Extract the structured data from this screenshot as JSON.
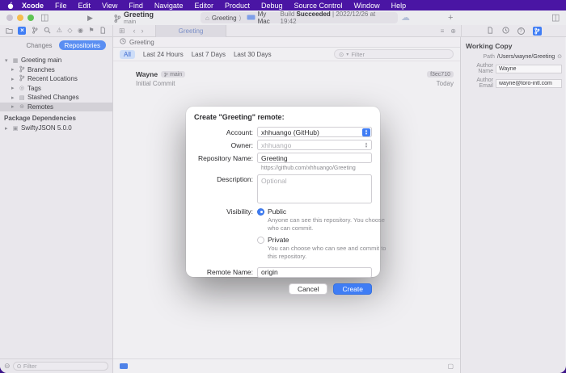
{
  "colors": {
    "accent": "#3F7DF5",
    "menubar_bg": "#4A15A4",
    "segment_selected": "#5A8EF2"
  },
  "menubar": {
    "items": [
      "Xcode",
      "File",
      "Edit",
      "View",
      "Find",
      "Navigate",
      "Editor",
      "Product",
      "Debug",
      "Source Control",
      "Window",
      "Help"
    ]
  },
  "icons": {
    "sidebar_left": "◫",
    "play": "▶",
    "cloud": "☁",
    "plus": "+",
    "sidebar_right": "◫",
    "grid": "⊞",
    "back": "‹",
    "forward": "›",
    "list": "≡",
    "split": "⊕",
    "warning": "⚠",
    "diamond": "◇",
    "gauge": "◉",
    "flag": "⚑",
    "scm_x": "×",
    "chevron_down": "▾",
    "chevron_right": "▸",
    "repo": "▦",
    "tags": "◎",
    "stash": "▤",
    "remotes": "⊛",
    "package": "▣",
    "minus_circle": "⊖",
    "filter_circle": "⊙",
    "reveal": "⊙",
    "house": "⌂",
    "help": "?",
    "small_square": "▢"
  },
  "toolbar": {
    "project": "Greeting",
    "branch": "main",
    "scheme": "Greeting",
    "scheme_sep": "⟩",
    "destination": "My Mac",
    "build_prefix": "Build",
    "build_status": "Succeeded",
    "build_time": "| 2022/12/26 at 19:42"
  },
  "tabbar": {
    "active_tab": "Greeting"
  },
  "sidebar": {
    "segments": {
      "changes": "Changes",
      "repositories": "Repositories"
    },
    "tree": [
      {
        "label": "Greeting main"
      },
      {
        "label": "Branches"
      },
      {
        "label": "Recent Locations"
      },
      {
        "label": "Tags"
      },
      {
        "label": "Stashed Changes"
      },
      {
        "label": "Remotes"
      }
    ],
    "section_title": "Package Dependencies",
    "package": "SwiftyJSON 5.0.0",
    "filter_placeholder": "Filter"
  },
  "editor": {
    "jumpbar": "Greeting",
    "filters": [
      "All",
      "Last 24 Hours",
      "Last 7 Days",
      "Last 30 Days"
    ],
    "filter_placeholder": "Filter",
    "commit": {
      "author": "Wayne",
      "branch_badge": "main",
      "message": "Initial Commit",
      "hash": "f3ec710",
      "date": "Today"
    }
  },
  "inspector": {
    "title": "Working Copy",
    "path_label": "Path",
    "path_value": "/Users/wayne/Greeting",
    "name_label": "Author Name",
    "name_value": "Wayne",
    "email_label": "Author Email",
    "email_value": "wayne@toro-intl.com"
  },
  "dialog": {
    "title": "Create \"Greeting\" remote:",
    "account_label": "Account:",
    "account_value": "xhhuango (GitHub)",
    "owner_label": "Owner:",
    "owner_placeholder": "xhhuango",
    "repo_label": "Repository Name:",
    "repo_value": "Greeting",
    "repo_url": "https://github.com/xhhuango/Greeting",
    "desc_label": "Description:",
    "desc_placeholder": "Optional",
    "visibility_label": "Visibility:",
    "public_label": "Public",
    "public_caption": "Anyone can see this repository. You choose who can commit.",
    "private_label": "Private",
    "private_caption": "You can choose who can see and commit to this repository.",
    "remote_label": "Remote Name:",
    "remote_value": "origin",
    "cancel": "Cancel",
    "create": "Create"
  }
}
